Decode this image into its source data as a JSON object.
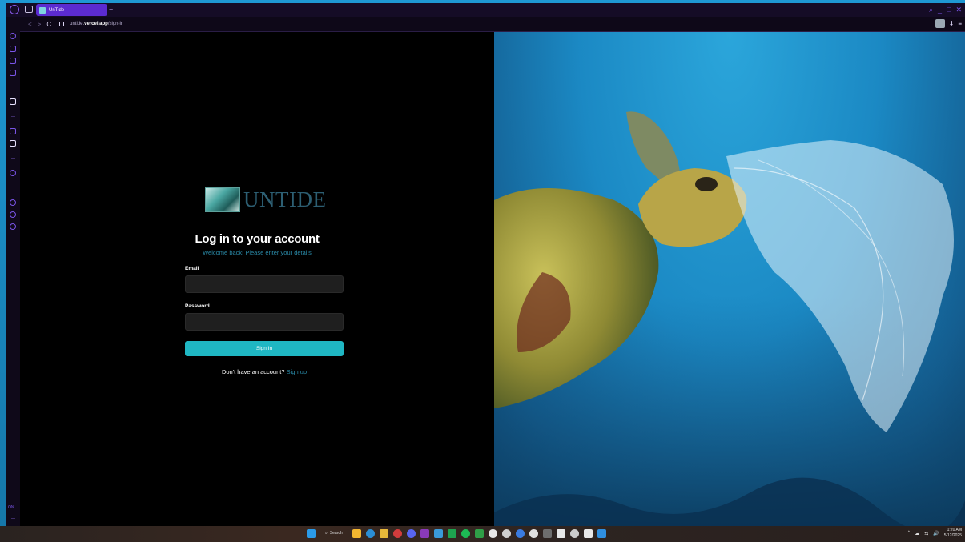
{
  "browser": {
    "tab_title": "UnTide",
    "new_tab_label": "+",
    "window_controls": [
      "⌕",
      "_",
      "□",
      "✕"
    ],
    "url_prefix": "untide.",
    "url_domain": "vercel.app",
    "url_path": "/sign-in",
    "nav": {
      "back": "<",
      "forward": ">",
      "reload": "C"
    },
    "right_icons": [
      "⬇",
      "≡"
    ],
    "sidebar_text": "ON"
  },
  "login": {
    "logo_text": "UNTIDE",
    "heading": "Log in to your account",
    "subheading": "Welcome back! Please enter your details",
    "email_label": "Email",
    "email_value": "",
    "password_label": "Password",
    "password_value": "",
    "signin_label": "Sign In",
    "signup_prompt": "Don't have an account?",
    "signup_link": "Sign up"
  },
  "photo": {
    "subject": "sea-turtle-with-plastic-bag",
    "colors": {
      "water": "#1b89c4",
      "turtle": "#a79a3e",
      "plastic": "#e6f4fb"
    }
  },
  "taskbar": {
    "search_label": "Search",
    "tray_icons": [
      "^",
      "☁",
      "⇆",
      "🔊"
    ],
    "time": "1:20 AM",
    "date": "5/12/2025",
    "app_colors": [
      "#f2b630",
      "#2b8fd6",
      "#e7b83a",
      "#d23c3c",
      "#5865f2",
      "#8a3ab9",
      "#3a9ad9",
      "#1ea34f",
      "#1db954",
      "#2f9e47",
      "#ffffff",
      "#e8e8e8",
      "#3a7be0",
      "#ffffff",
      "#6e6e6e",
      "#ffffff",
      "#cccccc",
      "#ffffff",
      "#2f8fe0"
    ]
  }
}
